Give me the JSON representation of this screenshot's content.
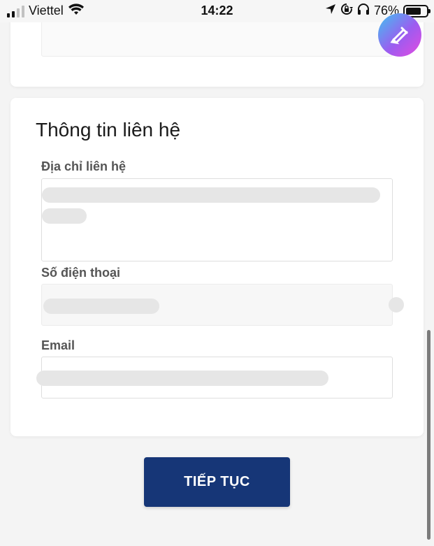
{
  "status_bar": {
    "carrier": "Viettel",
    "time": "14:22",
    "battery_percent": "76%",
    "battery_level": 0.76,
    "icons": [
      "signal-icon",
      "wifi-icon",
      "location-arrow-icon",
      "orientation-lock-icon",
      "headphones-icon",
      "battery-icon"
    ]
  },
  "contact_section": {
    "title": "Thông tin liên hệ",
    "address": {
      "label": "Địa chỉ liên hệ",
      "value": ""
    },
    "phone": {
      "label": "Số điện thoại",
      "value": ""
    },
    "email": {
      "label": "Email",
      "value": ""
    }
  },
  "actions": {
    "continue_label": "TIẾP TỤC"
  },
  "floating_button": {
    "icon": "pencil-edit-icon"
  },
  "colors": {
    "primary_button": "#163677",
    "card_background": "#ffffff",
    "page_background": "#f4f4f4"
  }
}
